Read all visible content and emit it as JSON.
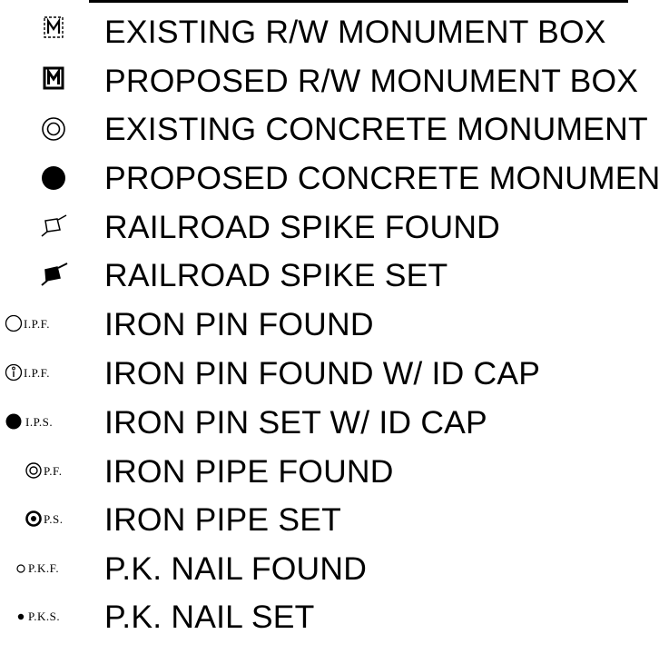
{
  "legend": {
    "items": [
      {
        "symbol": "existing-rw-monument-box-icon",
        "abbr": "",
        "label": "EXISTING R/W MONUMENT BOX"
      },
      {
        "symbol": "proposed-rw-monument-box-icon",
        "abbr": "",
        "label": "PROPOSED R/W MONUMENT BOX"
      },
      {
        "symbol": "existing-concrete-monument-icon",
        "abbr": "",
        "label": "EXISTING CONCRETE MONUMENT"
      },
      {
        "symbol": "proposed-concrete-monument-icon",
        "abbr": "",
        "label": "PROPOSED CONCRETE MONUMENT"
      },
      {
        "symbol": "railroad-spike-found-icon",
        "abbr": "",
        "label": "RAILROAD SPIKE FOUND"
      },
      {
        "symbol": "railroad-spike-set-icon",
        "abbr": "",
        "label": "RAILROAD SPIKE SET"
      },
      {
        "symbol": "iron-pin-found-icon",
        "abbr": "I.P.F.",
        "label": "IRON PIN FOUND"
      },
      {
        "symbol": "iron-pin-found-id-cap-icon",
        "abbr": "I.P.F.",
        "label": "IRON PIN FOUND W/ ID CAP"
      },
      {
        "symbol": "iron-pin-set-id-cap-icon",
        "abbr": "I.P.S.",
        "label": "IRON PIN SET W/ ID CAP"
      },
      {
        "symbol": "iron-pipe-found-icon",
        "abbr": "P.F.",
        "label": "IRON PIPE FOUND"
      },
      {
        "symbol": "iron-pipe-set-icon",
        "abbr": "P.S.",
        "label": "IRON PIPE SET"
      },
      {
        "symbol": "pk-nail-found-icon",
        "abbr": "P.K.F.",
        "label": "P.K. NAIL FOUND"
      },
      {
        "symbol": "pk-nail-set-icon",
        "abbr": "P.K.S.",
        "label": "P.K. NAIL SET"
      }
    ]
  }
}
